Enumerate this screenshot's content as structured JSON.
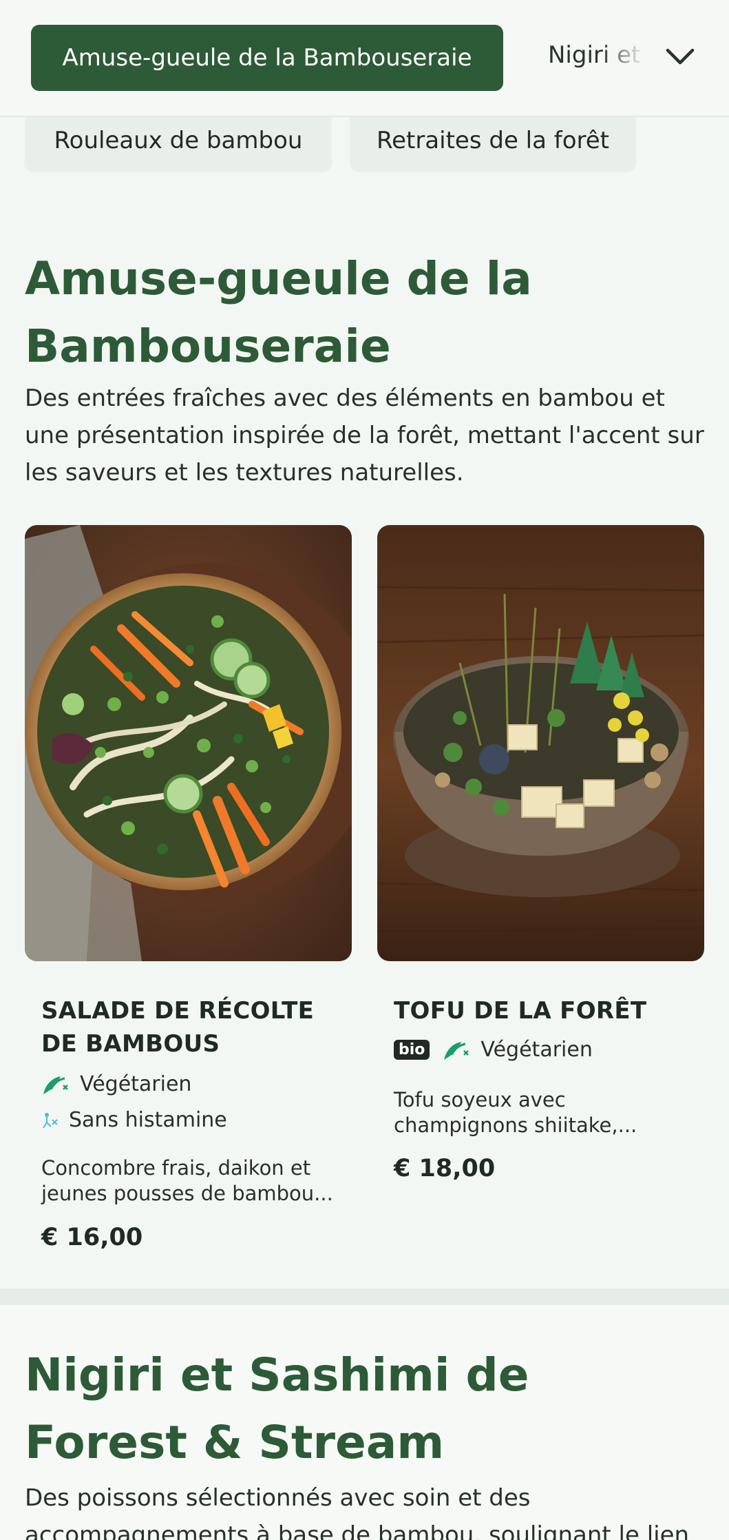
{
  "nav": {
    "active_category": "Amuse-gueule de la Bambouseraie",
    "next_category": "Nigiri et Sashimi de Forest & Stream",
    "pills": [
      "Rouleaux de bambou",
      "Retraites de la forêt"
    ]
  },
  "section1": {
    "title": "Amuse-gueule de la Bambouseraie",
    "description": "Des entrées fraîches avec des éléments en bambou et une présentation inspirée de la forêt, mettant l'accent sur les saveurs et les textures naturelles."
  },
  "dishes": [
    {
      "name": "SALADE DE RÉCOLTE DE BAMBOUS",
      "tags": [
        "Végétarien",
        "Sans histamine"
      ],
      "description": "Concombre frais, daikon et jeunes pousses de bambou...",
      "price": "€ 16,00"
    },
    {
      "name": "TOFU DE LA FORÊT",
      "badge": "bio",
      "tags": [
        "Végétarien"
      ],
      "description": "Tofu soyeux avec champignons shiitake,...",
      "price": "€ 18,00"
    }
  ],
  "section2": {
    "title": "Nigiri et Sashimi de Forest & Stream",
    "description": "Des poissons sélectionnés avec soin et des accompagnements à base de bambou, soulignant le lien"
  },
  "colors": {
    "accent": "#2d5a37",
    "background": "#f3f7f3",
    "vegetarian_icon": "#1a9e6a",
    "histamine_icon": "#4fb8d9"
  }
}
